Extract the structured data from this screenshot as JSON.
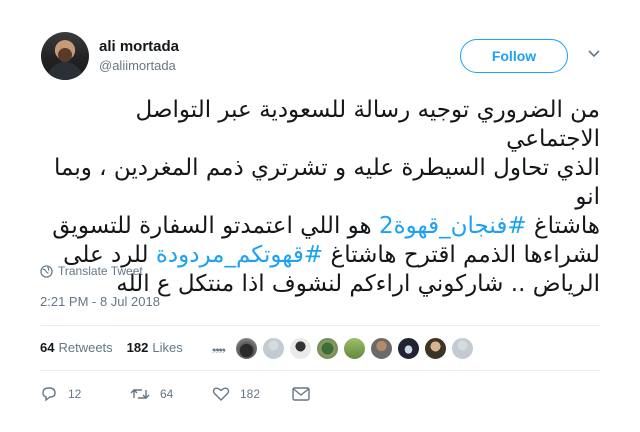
{
  "author": {
    "name": "ali mortada",
    "handle": "@aliimortada",
    "follow_label": "Follow"
  },
  "tweet": {
    "line1": "من الضروري توجيه رسالة للسعودية عبر التواصل الاجتماعي",
    "line2": "الذي تحاول السيطرة عليه و تشرتري ذمم المغردين ، وبما انو",
    "line3_pre": "هاشتاغ ",
    "hashtag1": "#فنجان_قهوة2",
    "line3_post": " هو اللي اعتمدتو السفارة للتسويق",
    "line4_pre": "لشراءها الذمم اقترح هاشتاغ ",
    "hashtag2": "#قهوتكم_مردودة",
    "line4_post": " للرد على",
    "line5": "الرياض .. شاركوني اراءكم لنشوف اذا منتكل ع الله"
  },
  "translate_label": "Translate Tweet",
  "timestamp": "2:21 PM - 8 Jul 2018",
  "stats": {
    "retweets_count": "64",
    "retweets_label": "Retweets",
    "likes_count": "182",
    "likes_label": "Likes"
  },
  "actions": {
    "replies": "12",
    "retweets": "64",
    "likes": "182"
  },
  "colors": {
    "accent": "#1da1f2",
    "muted": "#657786",
    "text": "#14171a"
  }
}
